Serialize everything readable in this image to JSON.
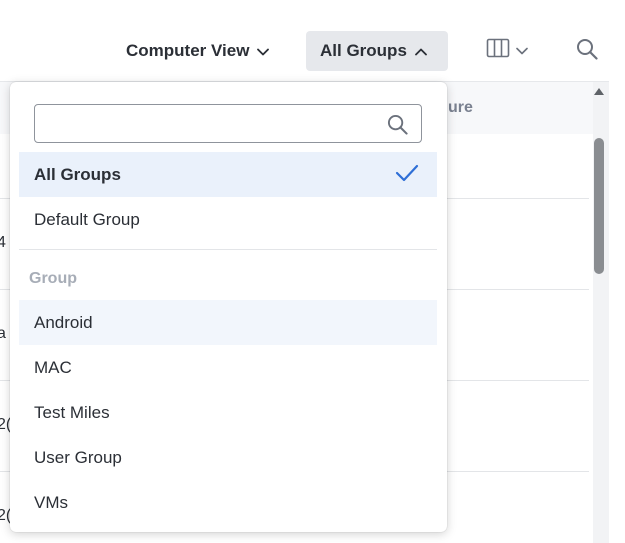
{
  "toolbar": {
    "view_label": "Computer View",
    "groups_label": "All Groups"
  },
  "table": {
    "header_partial": "ure",
    "row_edge_chars": [
      "4",
      "a",
      "2(",
      "2("
    ]
  },
  "dropdown": {
    "search": {
      "value": "",
      "placeholder": ""
    },
    "items_top": [
      {
        "label": "All Groups",
        "selected": true
      },
      {
        "label": "Default Group",
        "selected": false
      }
    ],
    "group_header": "Group",
    "items_group": [
      {
        "label": "Android",
        "hovered": true
      },
      {
        "label": "MAC"
      },
      {
        "label": "Test Miles"
      },
      {
        "label": "User Group"
      },
      {
        "label": "VMs"
      }
    ]
  },
  "colors": {
    "accent": "#2f6fd6",
    "selected_bg": "#eaf1fb",
    "hover_bg": "#f2f6fc",
    "button_bg": "#e6e8ec"
  },
  "icons": [
    "chevron-down-icon",
    "chevron-up-icon",
    "columns-icon",
    "search-icon",
    "check-icon"
  ]
}
